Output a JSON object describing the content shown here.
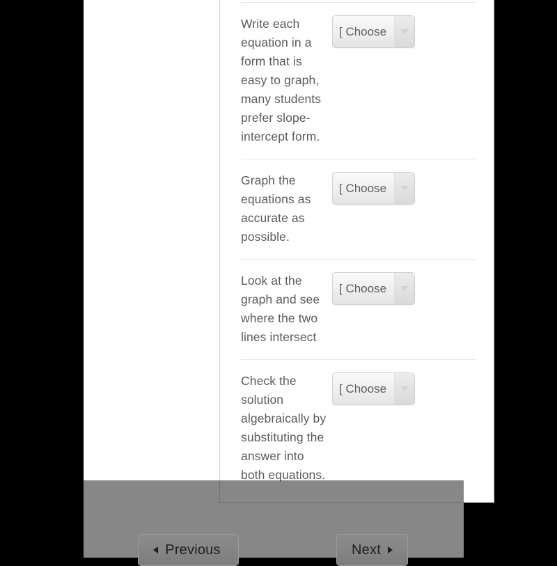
{
  "quiz": {
    "questions": [
      {
        "prompt": "Write each equation in a form that is easy to graph, many students prefer slope-intercept form.",
        "answer_value": "[ Choose"
      },
      {
        "prompt": "Graph the equations as accurate as possible.",
        "answer_value": "[ Choose"
      },
      {
        "prompt": "Look at the graph and see where the two lines intersect",
        "answer_value": "[ Choose"
      },
      {
        "prompt": "Check the solution algebraically by substituting the answer into both equations.",
        "answer_value": "[ Choose"
      }
    ]
  },
  "navigation": {
    "previous_label": "Previous",
    "next_label": "Next"
  },
  "colors": {
    "text": "#5b5b5b",
    "divider": "#e6e6e6",
    "panel_border": "#d4d4d4",
    "overlay": "#808080",
    "letterbox": "#000000"
  }
}
